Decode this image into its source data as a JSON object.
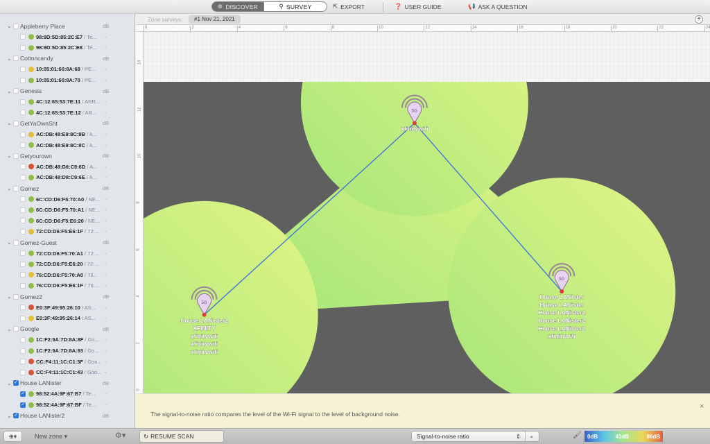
{
  "toolbar": {
    "discover": "DISCOVER",
    "survey": "SURVEY",
    "export": "EXPORT",
    "user_guide": "USER GUIDE",
    "ask": "ASK A QUESTION"
  },
  "zone": {
    "label": "Zone surveys:",
    "survey_tab": "#1 Nov 21, 2021",
    "add": "+"
  },
  "ruler": {
    "x_ticks": [
      0,
      2,
      4,
      6,
      8,
      10,
      12,
      14,
      16,
      18,
      20,
      22,
      24
    ],
    "y_ticks": [
      14,
      12,
      10,
      8,
      6,
      4,
      2,
      0
    ]
  },
  "colors": {
    "good": "#8fbf4a",
    "fair": "#e6bf3a",
    "poor": "#d9533a",
    "coverage": "#b8ec7a",
    "background": "#5f5f5f",
    "link": "#3b6fe0"
  },
  "sidebar": {
    "unit": "dB",
    "groups": [
      {
        "name": "Appleberry  Place",
        "checked": false,
        "aps": [
          {
            "mac": "98:9D:5D:85:2C:E7",
            "vendor": " / Te...",
            "status": "good"
          },
          {
            "mac": "98:9D:5D:85:2C:E8",
            "vendor": " / Te...",
            "status": "good"
          }
        ]
      },
      {
        "name": "Cottoncandy",
        "checked": false,
        "aps": [
          {
            "mac": "10:05:01:60:8A:68",
            "vendor": " / PE...",
            "status": "fair"
          },
          {
            "mac": "10:05:01:60:8A:70",
            "vendor": " / PE...",
            "status": "good"
          }
        ]
      },
      {
        "name": "Genesis",
        "checked": false,
        "aps": [
          {
            "mac": "4C:12:65:53:7E:11",
            "vendor": " / ARR...",
            "status": "good"
          },
          {
            "mac": "4C:12:65:53:7E:12",
            "vendor": " / AR...",
            "status": "good"
          }
        ]
      },
      {
        "name": "GetYaOwnSht",
        "checked": false,
        "aps": [
          {
            "mac": "AC:DB:48:E9:8C:8B",
            "vendor": " / A...",
            "status": "fair"
          },
          {
            "mac": "AC:DB:48:E9:8C:8C",
            "vendor": " / A...",
            "status": "good"
          }
        ]
      },
      {
        "name": "Getyourown",
        "checked": false,
        "aps": [
          {
            "mac": "AC:DB:48:D8:C9:6D",
            "vendor": " / A...",
            "status": "poor"
          },
          {
            "mac": "AC:DB:48:D8:C9:6E",
            "vendor": " / A...",
            "status": "good"
          }
        ]
      },
      {
        "name": "Gomez",
        "checked": false,
        "aps": [
          {
            "mac": "6C:CD:D6:F5:70:A0",
            "vendor": " / NE...",
            "status": "good"
          },
          {
            "mac": "6C:CD:D6:F5:70:A1",
            "vendor": " / NE...",
            "status": "good"
          },
          {
            "mac": "6C:CD:D6:F5:E6:20",
            "vendor": " / NE...",
            "status": "good"
          },
          {
            "mac": "72:CD:D6:F5:E6:1F",
            "vendor": " / 72:...",
            "status": "fair"
          }
        ]
      },
      {
        "name": "Gomez-Guest",
        "checked": false,
        "aps": [
          {
            "mac": "72:CD:D6:F5:70:A1",
            "vendor": " / 72:...",
            "status": "good"
          },
          {
            "mac": "72:CD:D6:F5:E6:20",
            "vendor": " / 72:...",
            "status": "good"
          },
          {
            "mac": "76:CD:D6:F5:70:A0",
            "vendor": " / 76...",
            "status": "fair"
          },
          {
            "mac": "76:CD:D6:F5:E6:1F",
            "vendor": " / 76:...",
            "status": "good"
          }
        ]
      },
      {
        "name": "Gomez2",
        "checked": false,
        "aps": [
          {
            "mac": "E0:3F:49:95:26:10",
            "vendor": " / AS...",
            "status": "poor"
          },
          {
            "mac": "E0:3F:49:95:26:14",
            "vendor": " / AS...",
            "status": "fair"
          }
        ]
      },
      {
        "name": "Google",
        "checked": false,
        "aps": [
          {
            "mac": "1C:F2:9A:7D:8A:8F",
            "vendor": " / Go...",
            "status": "good"
          },
          {
            "mac": "1C:F2:9A:7D:8A:93",
            "vendor": " / Go...",
            "status": "good"
          },
          {
            "mac": "CC:F4:11:1C:C1:3F",
            "vendor": " / Goo...",
            "status": "poor"
          },
          {
            "mac": "CC:F4:11:1C:C1:43",
            "vendor": " / Goo...",
            "status": "poor"
          }
        ]
      },
      {
        "name": "House LANister",
        "checked": true,
        "aps": [
          {
            "mac": "98:52:4A:9F:67:B7",
            "vendor": " / Te...",
            "status": "good",
            "checked": true
          },
          {
            "mac": "98:52:4A:9F:67:BF",
            "vendor": " / Te...",
            "status": "good",
            "checked": true
          }
        ]
      },
      {
        "name": "House LANister2",
        "checked": true,
        "aps": []
      }
    ],
    "ap_value": "-"
  },
  "map": {
    "access_points": [
      {
        "band": "5G",
        "position_m": [
          2.6,
          3.3
        ],
        "labels": [
          "House LANister2",
          "XFINITY",
          "xfinitywifi",
          "xfinitywifi",
          "xfinitywifi"
        ]
      },
      {
        "band": "5G",
        "position_m": [
          11.6,
          11.5
        ],
        "labels": [
          "xfinitywifi"
        ]
      },
      {
        "band": "5G",
        "position_m": [
          17.9,
          4.3
        ],
        "labels": [
          "House LANister",
          "House LANister",
          "House LANister2",
          "House LANister2",
          "House LANister2",
          "xfinitywifi"
        ]
      }
    ]
  },
  "info": {
    "text": "The signal-to-noise ratio compares the level of the Wi-Fi signal to the level of background noise.",
    "close": "×"
  },
  "bottom": {
    "new_zone": "New zone ▾",
    "resume": "RESUME SCAN",
    "visualization": "Signal-to-noise ratio",
    "legend": [
      "0dB",
      "43dB",
      "86dB"
    ]
  }
}
